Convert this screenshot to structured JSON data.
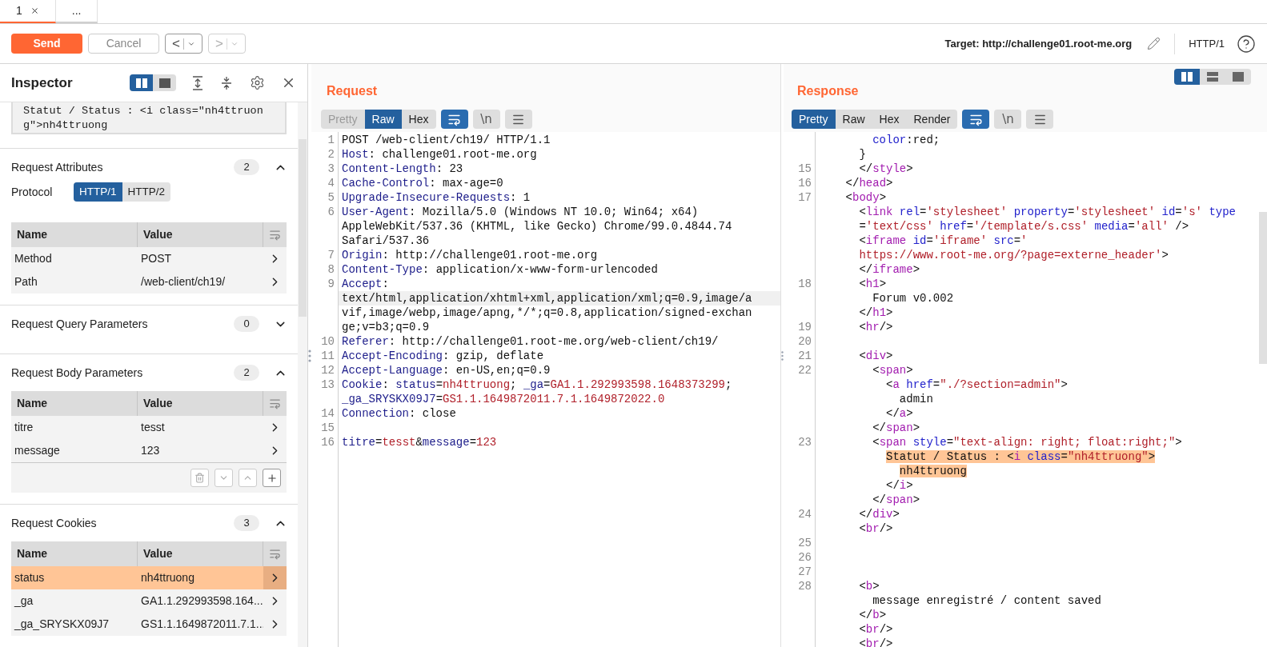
{
  "tabs": [
    {
      "label": "1",
      "selected": true,
      "closable": true
    },
    {
      "label": "...",
      "selected": false,
      "closable": false
    }
  ],
  "toolbar": {
    "send": "Send",
    "cancel": "Cancel",
    "back": "<",
    "forward": ">",
    "forward_disabled": true,
    "target": "Target: http://challenge01.root-me.org",
    "protocol": "HTTP/1"
  },
  "inspector": {
    "title": "Inspector",
    "layouts": [
      {
        "kind": "sidebar",
        "selected": true
      },
      {
        "kind": "panel",
        "selected": false
      }
    ],
    "selection_text": "Statut / Status : <i class=\"nh4ttruong\">nh4ttruong",
    "sections": [
      {
        "title": "Request Attributes",
        "count": "2",
        "expanded": true,
        "protocol": {
          "label": "Protocol",
          "options": [
            {
              "label": "HTTP/1",
              "selected": true
            },
            {
              "label": "HTTP/2",
              "selected": false
            }
          ]
        },
        "columns": [
          "Name",
          "Value"
        ],
        "rows": [
          {
            "name": "Method",
            "value": "POST",
            "selected": false
          },
          {
            "name": "Path",
            "value": "/web-client/ch19/",
            "selected": false
          }
        ]
      },
      {
        "title": "Request Query Parameters",
        "count": "0",
        "expanded": false
      },
      {
        "title": "Request Body Parameters",
        "count": "2",
        "expanded": true,
        "columns": [
          "Name",
          "Value"
        ],
        "rows": [
          {
            "name": "titre",
            "value": "tesst",
            "selected": false
          },
          {
            "name": "message",
            "value": "123",
            "selected": false
          }
        ],
        "row_actions": true
      },
      {
        "title": "Request Cookies",
        "count": "3",
        "expanded": true,
        "columns": [
          "Name",
          "Value"
        ],
        "rows": [
          {
            "name": "status",
            "value": "nh4ttruong",
            "selected": true
          },
          {
            "name": "_ga",
            "value": "GA1.1.292993598.164...",
            "selected": false
          },
          {
            "name": "_ga_SRYSKX09J7",
            "value": "GS1.1.1649872011.7.1...",
            "selected": false
          }
        ]
      }
    ]
  },
  "request": {
    "title": "Request",
    "views": [
      {
        "label": "Pretty",
        "selected": false,
        "disabled": true
      },
      {
        "label": "Raw",
        "selected": true,
        "disabled": false
      },
      {
        "label": "Hex",
        "selected": false,
        "disabled": false
      }
    ],
    "wrap_on": true,
    "newline": "\\n",
    "lines": [
      {
        "num": "1",
        "segments": [
          {
            "kind": "plain",
            "text": "POST /web-client/ch19/ HTTP/1.1"
          }
        ]
      },
      {
        "num": "2",
        "segments": [
          {
            "kind": "key",
            "text": "Host"
          },
          {
            "kind": "plain",
            "text": ": challenge01.root-me.org"
          }
        ]
      },
      {
        "num": "3",
        "segments": [
          {
            "kind": "key",
            "text": "Content-Length"
          },
          {
            "kind": "plain",
            "text": ": 23"
          }
        ]
      },
      {
        "num": "4",
        "segments": [
          {
            "kind": "key",
            "text": "Cache-Control"
          },
          {
            "kind": "plain",
            "text": ": max-age=0"
          }
        ]
      },
      {
        "num": "5",
        "segments": [
          {
            "kind": "key",
            "text": "Upgrade-Insecure-Requests"
          },
          {
            "kind": "plain",
            "text": ": 1"
          }
        ]
      },
      {
        "num": "6",
        "segments": [
          {
            "kind": "key",
            "text": "User-Agent"
          },
          {
            "kind": "plain",
            "text": ": Mozilla/5.0 (Windows NT 10.0; Win64; x64)"
          }
        ]
      },
      {
        "segments": [
          {
            "kind": "plain",
            "text": "AppleWebKit/537.36 (KHTML, like Gecko) Chrome/99.0.4844.74"
          }
        ]
      },
      {
        "segments": [
          {
            "kind": "plain",
            "text": "Safari/537.36"
          }
        ]
      },
      {
        "num": "7",
        "segments": [
          {
            "kind": "key",
            "text": "Origin"
          },
          {
            "kind": "plain",
            "text": ": http://challenge01.root-me.org"
          }
        ]
      },
      {
        "num": "8",
        "segments": [
          {
            "kind": "key",
            "text": "Content-Type"
          },
          {
            "kind": "plain",
            "text": ": application/x-www-form-urlencoded"
          }
        ]
      },
      {
        "num": "9",
        "segments": [
          {
            "kind": "key",
            "text": "Accept"
          },
          {
            "kind": "plain",
            "text": ":"
          }
        ]
      },
      {
        "current": true,
        "segments": [
          {
            "kind": "plain",
            "text": "text/html,application/xhtml+xml,application/xml;q=0.9,image/a"
          }
        ]
      },
      {
        "segments": [
          {
            "kind": "plain",
            "text": "vif,image/webp,image/apng,*/*;q=0.8,application/signed-exchan"
          }
        ]
      },
      {
        "segments": [
          {
            "kind": "plain",
            "text": "ge;v=b3;q=0.9"
          }
        ]
      },
      {
        "num": "10",
        "segments": [
          {
            "kind": "key",
            "text": "Referer"
          },
          {
            "kind": "plain",
            "text": ": http://challenge01.root-me.org/web-client/ch19/"
          }
        ]
      },
      {
        "num": "11",
        "segments": [
          {
            "kind": "key",
            "text": "Accept-Encoding"
          },
          {
            "kind": "plain",
            "text": ": gzip, deflate"
          }
        ]
      },
      {
        "num": "12",
        "segments": [
          {
            "kind": "key",
            "text": "Accept-Language"
          },
          {
            "kind": "plain",
            "text": ": en-US,en;q=0.9"
          }
        ]
      },
      {
        "num": "13",
        "segments": [
          {
            "kind": "key",
            "text": "Cookie"
          },
          {
            "kind": "plain",
            "text": ": "
          },
          {
            "kind": "key",
            "text": "status"
          },
          {
            "kind": "plain",
            "text": "="
          },
          {
            "kind": "value",
            "text": "nh4ttruong"
          },
          {
            "kind": "plain",
            "text": "; "
          },
          {
            "kind": "key",
            "text": "_ga"
          },
          {
            "kind": "plain",
            "text": "="
          },
          {
            "kind": "value",
            "text": "GA1.1.292993598.1648373299"
          },
          {
            "kind": "plain",
            "text": ";"
          }
        ]
      },
      {
        "segments": [
          {
            "kind": "key",
            "text": "_ga_SRYSKX09J7"
          },
          {
            "kind": "plain",
            "text": "="
          },
          {
            "kind": "value",
            "text": "GS1.1.1649872011.7.1.1649872022.0"
          }
        ]
      },
      {
        "num": "14",
        "segments": [
          {
            "kind": "key",
            "text": "Connection"
          },
          {
            "kind": "plain",
            "text": ": close"
          }
        ]
      },
      {
        "num": "15"
      },
      {
        "num": "16",
        "segments": [
          {
            "kind": "key",
            "text": "titre"
          },
          {
            "kind": "plain",
            "text": "="
          },
          {
            "kind": "value",
            "text": "tesst"
          },
          {
            "kind": "plain",
            "text": "&"
          },
          {
            "kind": "key",
            "text": "message"
          },
          {
            "kind": "plain",
            "text": "="
          },
          {
            "kind": "value",
            "text": "123"
          }
        ]
      }
    ]
  },
  "response": {
    "title": "Response",
    "layouts": [
      {
        "kind": "columns",
        "selected": true
      },
      {
        "kind": "rows",
        "selected": false
      },
      {
        "kind": "single",
        "selected": false
      }
    ],
    "views": [
      {
        "label": "Pretty",
        "selected": true,
        "disabled": false
      },
      {
        "label": "Raw",
        "selected": false,
        "disabled": false
      },
      {
        "label": "Hex",
        "selected": false,
        "disabled": false
      },
      {
        "label": "Render",
        "selected": false,
        "disabled": false
      }
    ],
    "wrap_on": true,
    "newline": "\\n",
    "lines": [
      {
        "segments": [
          {
            "kind": "attr",
            "text": "        color"
          },
          {
            "kind": "plain",
            "text": ":red;"
          }
        ]
      },
      {
        "segments": [
          {
            "kind": "plain",
            "text": "      }"
          }
        ]
      },
      {
        "num": "15",
        "segments": [
          {
            "kind": "plain",
            "text": "      </"
          },
          {
            "kind": "tag",
            "text": "style"
          },
          {
            "kind": "plain",
            "text": ">"
          }
        ]
      },
      {
        "num": "16",
        "segments": [
          {
            "kind": "plain",
            "text": "    </"
          },
          {
            "kind": "tag",
            "text": "head"
          },
          {
            "kind": "plain",
            "text": ">"
          }
        ]
      },
      {
        "num": "17",
        "segments": [
          {
            "kind": "plain",
            "text": "    <"
          },
          {
            "kind": "tag",
            "text": "body"
          },
          {
            "kind": "plain",
            "text": ">"
          }
        ]
      },
      {
        "segments": [
          {
            "kind": "plain",
            "text": "      <"
          },
          {
            "kind": "tag",
            "text": "link"
          },
          {
            "kind": "attr",
            "text": " rel"
          },
          {
            "kind": "plain",
            "text": "="
          },
          {
            "kind": "value",
            "text": "'stylesheet'"
          },
          {
            "kind": "attr",
            "text": " property"
          },
          {
            "kind": "plain",
            "text": "="
          },
          {
            "kind": "value",
            "text": "'stylesheet'"
          },
          {
            "kind": "attr",
            "text": " id"
          },
          {
            "kind": "plain",
            "text": "="
          },
          {
            "kind": "value",
            "text": "'s'"
          },
          {
            "kind": "attr",
            "text": " type"
          }
        ]
      },
      {
        "segments": [
          {
            "kind": "plain",
            "text": "      ="
          },
          {
            "kind": "value",
            "text": "'text/css'"
          },
          {
            "kind": "attr",
            "text": " href"
          },
          {
            "kind": "plain",
            "text": "="
          },
          {
            "kind": "value",
            "text": "'/template/s.css'"
          },
          {
            "kind": "attr",
            "text": " media"
          },
          {
            "kind": "plain",
            "text": "="
          },
          {
            "kind": "value",
            "text": "'all'"
          },
          {
            "kind": "plain",
            "text": " />"
          }
        ]
      },
      {
        "segments": [
          {
            "kind": "plain",
            "text": "      <"
          },
          {
            "kind": "tag",
            "text": "iframe"
          },
          {
            "kind": "attr",
            "text": " id"
          },
          {
            "kind": "plain",
            "text": "="
          },
          {
            "kind": "value",
            "text": "'iframe'"
          },
          {
            "kind": "attr",
            "text": " src"
          },
          {
            "kind": "plain",
            "text": "="
          },
          {
            "kind": "value",
            "text": "'"
          }
        ]
      },
      {
        "segments": [
          {
            "kind": "value",
            "text": "      https://www.root-me.org/?page=externe_header'"
          },
          {
            "kind": "plain",
            "text": ">"
          }
        ]
      },
      {
        "segments": [
          {
            "kind": "plain",
            "text": "      </"
          },
          {
            "kind": "tag",
            "text": "iframe"
          },
          {
            "kind": "plain",
            "text": ">"
          }
        ]
      },
      {
        "num": "18",
        "segments": [
          {
            "kind": "plain",
            "text": "      <"
          },
          {
            "kind": "tag",
            "text": "h1"
          },
          {
            "kind": "plain",
            "text": ">"
          }
        ]
      },
      {
        "segments": [
          {
            "kind": "plain",
            "text": "        Forum v0.002"
          }
        ]
      },
      {
        "segments": [
          {
            "kind": "plain",
            "text": "      </"
          },
          {
            "kind": "tag",
            "text": "h1"
          },
          {
            "kind": "plain",
            "text": ">"
          }
        ]
      },
      {
        "num": "19",
        "segments": [
          {
            "kind": "plain",
            "text": "      <"
          },
          {
            "kind": "tag",
            "text": "hr"
          },
          {
            "kind": "plain",
            "text": "/>"
          }
        ]
      },
      {
        "num": "20"
      },
      {
        "num": "21",
        "segments": [
          {
            "kind": "plain",
            "text": "      <"
          },
          {
            "kind": "tag",
            "text": "div"
          },
          {
            "kind": "plain",
            "text": ">"
          }
        ]
      },
      {
        "num": "22",
        "segments": [
          {
            "kind": "plain",
            "text": "        <"
          },
          {
            "kind": "tag",
            "text": "span"
          },
          {
            "kind": "plain",
            "text": ">"
          }
        ]
      },
      {
        "segments": [
          {
            "kind": "plain",
            "text": "          <"
          },
          {
            "kind": "tag",
            "text": "a"
          },
          {
            "kind": "attr",
            "text": " href"
          },
          {
            "kind": "plain",
            "text": "="
          },
          {
            "kind": "value",
            "text": "\"./?section=admin\""
          },
          {
            "kind": "plain",
            "text": ">"
          }
        ]
      },
      {
        "segments": [
          {
            "kind": "plain",
            "text": "            admin"
          }
        ]
      },
      {
        "segments": [
          {
            "kind": "plain",
            "text": "          </"
          },
          {
            "kind": "tag",
            "text": "a"
          },
          {
            "kind": "plain",
            "text": ">"
          }
        ]
      },
      {
        "segments": [
          {
            "kind": "plain",
            "text": "        </"
          },
          {
            "kind": "tag",
            "text": "span"
          },
          {
            "kind": "plain",
            "text": ">"
          }
        ]
      },
      {
        "num": "23",
        "segments": [
          {
            "kind": "plain",
            "text": "        <"
          },
          {
            "kind": "tag",
            "text": "span"
          },
          {
            "kind": "attr",
            "text": " style"
          },
          {
            "kind": "plain",
            "text": "="
          },
          {
            "kind": "value",
            "text": "\"text-align: right; float:right;\""
          },
          {
            "kind": "plain",
            "text": ">"
          }
        ]
      },
      {
        "highlighted": true,
        "segments": [
          {
            "kind": "plain",
            "text": "          Statut / Status : <"
          },
          {
            "kind": "tag",
            "text": "i"
          },
          {
            "kind": "attr",
            "text": " class"
          },
          {
            "kind": "plain",
            "text": "="
          },
          {
            "kind": "value",
            "text": "\"nh4ttruong\""
          },
          {
            "kind": "plain",
            "text": ">"
          }
        ]
      },
      {
        "highlighted": true,
        "segments": [
          {
            "kind": "plain",
            "text": "            nh4ttruong"
          }
        ]
      },
      {
        "segments": [
          {
            "kind": "plain",
            "text": "          </"
          },
          {
            "kind": "tag",
            "text": "i"
          },
          {
            "kind": "plain",
            "text": ">"
          }
        ]
      },
      {
        "segments": [
          {
            "kind": "plain",
            "text": "        </"
          },
          {
            "kind": "tag",
            "text": "span"
          },
          {
            "kind": "plain",
            "text": ">"
          }
        ]
      },
      {
        "num": "24",
        "segments": [
          {
            "kind": "plain",
            "text": "      </"
          },
          {
            "kind": "tag",
            "text": "div"
          },
          {
            "kind": "plain",
            "text": ">"
          }
        ]
      },
      {
        "segments": [
          {
            "kind": "plain",
            "text": "      <"
          },
          {
            "kind": "tag",
            "text": "br"
          },
          {
            "kind": "plain",
            "text": "/>"
          }
        ]
      },
      {
        "num": "25"
      },
      {
        "num": "26"
      },
      {
        "num": "27"
      },
      {
        "num": "28",
        "segments": [
          {
            "kind": "plain",
            "text": "      <"
          },
          {
            "kind": "tag",
            "text": "b"
          },
          {
            "kind": "plain",
            "text": ">"
          }
        ]
      },
      {
        "segments": [
          {
            "kind": "plain",
            "text": "        message enregistré / content saved"
          }
        ]
      },
      {
        "segments": [
          {
            "kind": "plain",
            "text": "      </"
          },
          {
            "kind": "tag",
            "text": "b"
          },
          {
            "kind": "plain",
            "text": ">"
          }
        ]
      },
      {
        "segments": [
          {
            "kind": "plain",
            "text": "      <"
          },
          {
            "kind": "tag",
            "text": "br"
          },
          {
            "kind": "plain",
            "text": "/>"
          }
        ]
      },
      {
        "segments": [
          {
            "kind": "plain",
            "text": "      <"
          },
          {
            "kind": "tag",
            "text": "br"
          },
          {
            "kind": "plain",
            "text": "/>"
          }
        ]
      }
    ]
  }
}
